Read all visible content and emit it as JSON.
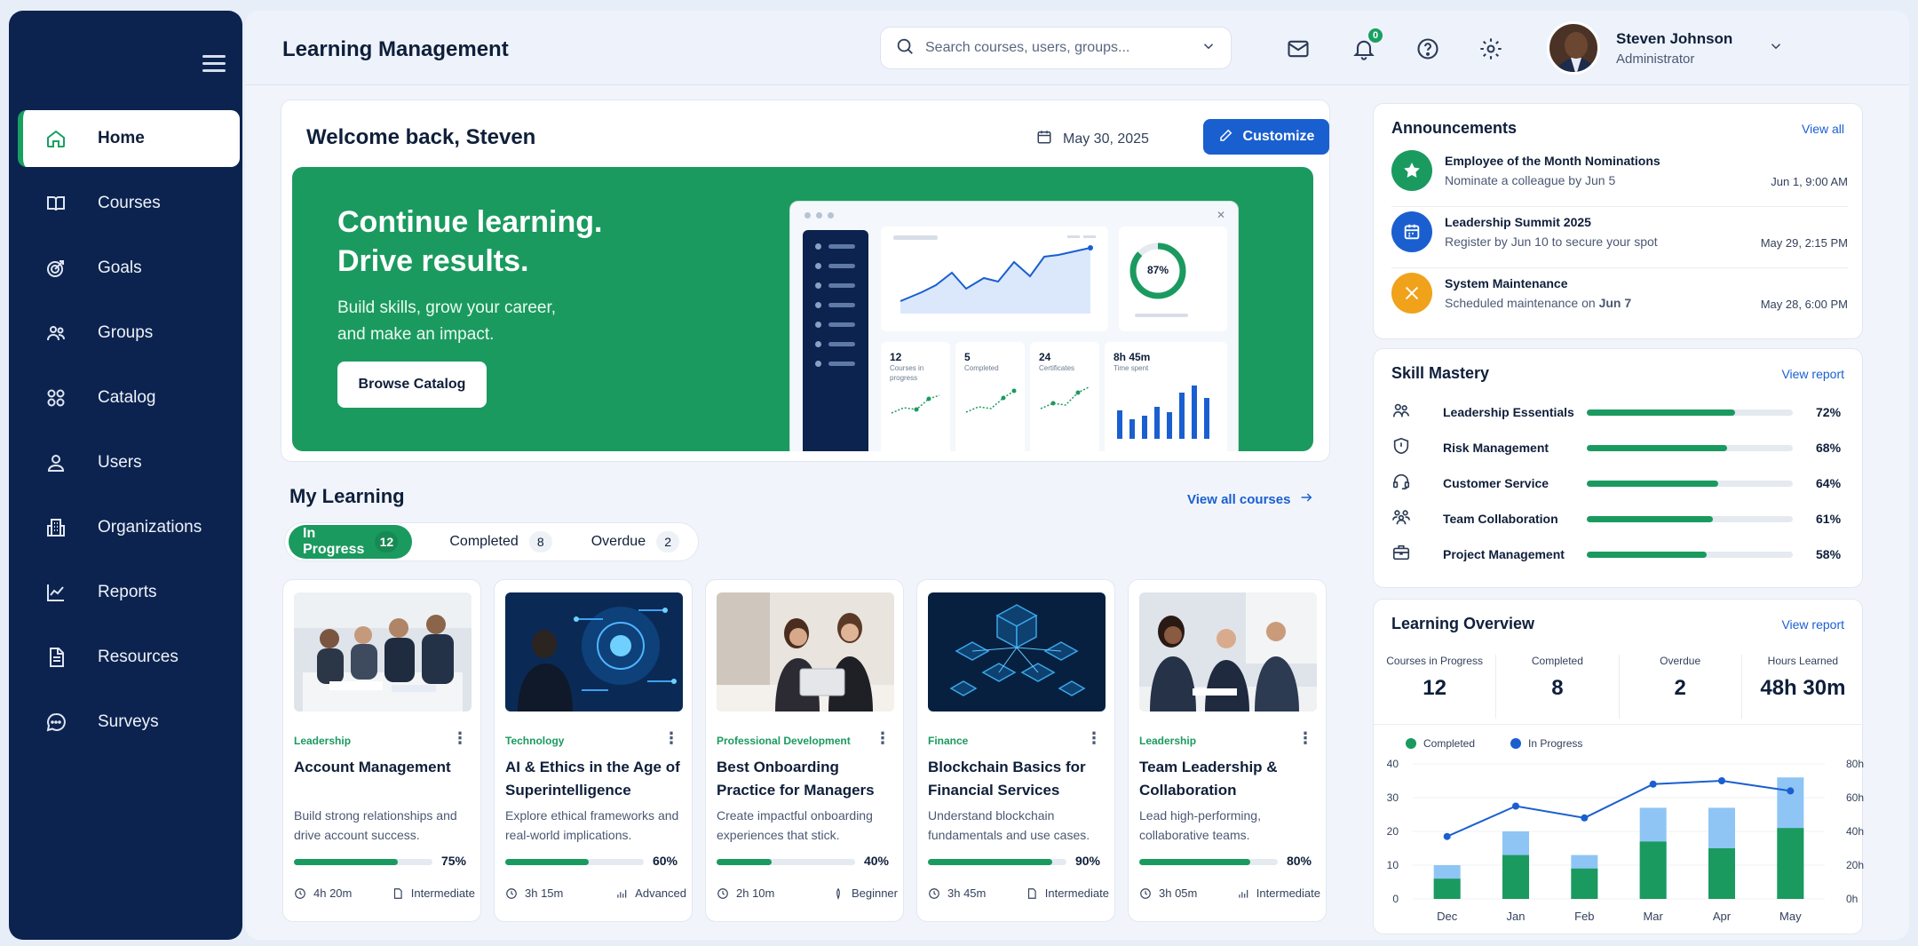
{
  "sidebar": {
    "items": [
      {
        "label": "Home",
        "icon": "home-icon",
        "active": true
      },
      {
        "label": "Courses",
        "icon": "book-icon"
      },
      {
        "label": "Goals",
        "icon": "target-icon"
      },
      {
        "label": "Groups",
        "icon": "groups-icon"
      },
      {
        "label": "Catalog",
        "icon": "catalog-icon"
      },
      {
        "label": "Users",
        "icon": "user-icon"
      },
      {
        "label": "Organizations",
        "icon": "building-icon"
      },
      {
        "label": "Reports",
        "icon": "chart-line-icon"
      },
      {
        "label": "Resources",
        "icon": "document-icon"
      },
      {
        "label": "Surveys",
        "icon": "chat-icon"
      }
    ]
  },
  "header": {
    "title": "Learning Management",
    "search_placeholder": "Search courses, users, groups...",
    "notification_count": "0",
    "user_name": "Steven Johnson",
    "user_role": "Administrator"
  },
  "welcome": {
    "title": "Welcome back, Steven",
    "date": "May 30, 2025",
    "customize_label": "Customize",
    "hero_heading_1": "Continue learning.",
    "hero_heading_2": "Drive results.",
    "hero_sub_1": "Build skills, grow your career,",
    "hero_sub_2": "and make an impact.",
    "browse_label": "Browse Catalog",
    "mock": {
      "donut_pct": "87%",
      "stats": [
        {
          "value": "12",
          "caption": "Courses in progress"
        },
        {
          "value": "5",
          "caption": "Completed"
        },
        {
          "value": "24",
          "caption": "Certificates"
        },
        {
          "value": "8h 45m",
          "caption": "Time spent"
        }
      ]
    }
  },
  "my_learning": {
    "title": "My Learning",
    "view_all": "View all courses",
    "tabs": [
      {
        "label": "In Progress",
        "count": "12"
      },
      {
        "label": "Completed",
        "count": "8"
      },
      {
        "label": "Overdue",
        "count": "2"
      }
    ],
    "courses": [
      {
        "category": "Leadership",
        "title": "Account Management",
        "desc": "Build strong relationships and drive account success.",
        "progress": 75,
        "progress_label": "75%",
        "duration": "4h 20m",
        "level": "Intermediate"
      },
      {
        "category": "Technology",
        "title": "AI & Ethics in the Age of Superintelligence",
        "desc": "Explore ethical frameworks and real-world implications.",
        "progress": 60,
        "progress_label": "60%",
        "duration": "3h 15m",
        "level": "Advanced"
      },
      {
        "category": "Professional Development",
        "title": "Best Onboarding Practice for Managers",
        "desc": "Create impactful onboarding experiences that stick.",
        "progress": 40,
        "progress_label": "40%",
        "duration": "2h 10m",
        "level": "Beginner"
      },
      {
        "category": "Finance",
        "title": "Blockchain Basics for Financial Services",
        "desc": "Understand blockchain fundamentals and use cases.",
        "progress": 90,
        "progress_label": "90%",
        "duration": "3h 45m",
        "level": "Intermediate"
      },
      {
        "category": "Leadership",
        "title": "Team Leadership & Collaboration",
        "desc": "Lead high-performing, collaborative teams.",
        "progress": 80,
        "progress_label": "80%",
        "duration": "3h 05m",
        "level": "Intermediate"
      }
    ]
  },
  "announcements": {
    "title": "Announcements",
    "view_all": "View all",
    "items": [
      {
        "title": "Employee of the Month Nominations",
        "subtitle": "Nominate a colleague by Jun 5",
        "time": "Jun 1, 9:00 AM",
        "color": "#1b9a5f",
        "icon": "star-icon"
      },
      {
        "title": "Leadership Summit 2025",
        "subtitle": "Register by Jun 10 to secure your spot",
        "time": "May 29, 2:15 PM",
        "color": "#1a5fd0",
        "icon": "calendar-icon"
      },
      {
        "title": "System Maintenance",
        "subtitle_prefix": "Scheduled maintenance on ",
        "subtitle_bold": "Jun 7",
        "time": "May 28, 6:00 PM",
        "color": "#f0a21a",
        "icon": "tools-icon"
      }
    ]
  },
  "skill_mastery": {
    "title": "Skill Mastery",
    "view_report": "View report",
    "items": [
      {
        "name": "Leadership Essentials",
        "value": 72,
        "label": "72%",
        "icon": "people-icon"
      },
      {
        "name": "Risk Management",
        "value": 68,
        "label": "68%",
        "icon": "shield-icon"
      },
      {
        "name": "Customer Service",
        "value": 64,
        "label": "64%",
        "icon": "headset-icon"
      },
      {
        "name": "Team Collaboration",
        "value": 61,
        "label": "61%",
        "icon": "team-icon"
      },
      {
        "name": "Project Management",
        "value": 58,
        "label": "58%",
        "icon": "briefcase-icon"
      }
    ]
  },
  "overview": {
    "title": "Learning Overview",
    "view_report": "View report",
    "stats": [
      {
        "label": "Courses in Progress",
        "value": "12"
      },
      {
        "label": "Completed",
        "value": "8"
      },
      {
        "label": "Overdue",
        "value": "2"
      },
      {
        "label": "Hours Learned",
        "value": "48h 30m"
      }
    ]
  },
  "chart_data": {
    "type": "bar",
    "categories": [
      "Dec",
      "Jan",
      "Feb",
      "Mar",
      "Apr",
      "May"
    ],
    "series": [
      {
        "name": "Completed",
        "values": [
          6,
          13,
          9,
          17,
          15,
          21
        ],
        "color": "#1b9a5f"
      },
      {
        "name": "In Progress",
        "values": [
          10,
          20,
          13,
          27,
          27,
          36
        ],
        "color": "#8ec5f5"
      }
    ],
    "line_series": {
      "name": "Hours Learned",
      "values": [
        37,
        55,
        48,
        68,
        70,
        64
      ],
      "color": "#1a5fd0",
      "axis": "right"
    },
    "y_left_ticks": [
      "0",
      "10",
      "20",
      "30",
      "40"
    ],
    "y_right_ticks": [
      "0h",
      "20h",
      "40h",
      "60h",
      "80h"
    ],
    "ylim_left": [
      0,
      40
    ],
    "ylim_right": [
      0,
      80
    ],
    "legend": [
      "Completed",
      "In Progress"
    ]
  },
  "colors": {
    "sidebar": "#0c2350",
    "accent_green": "#1b9a5f",
    "accent_blue": "#1a5fd0"
  }
}
